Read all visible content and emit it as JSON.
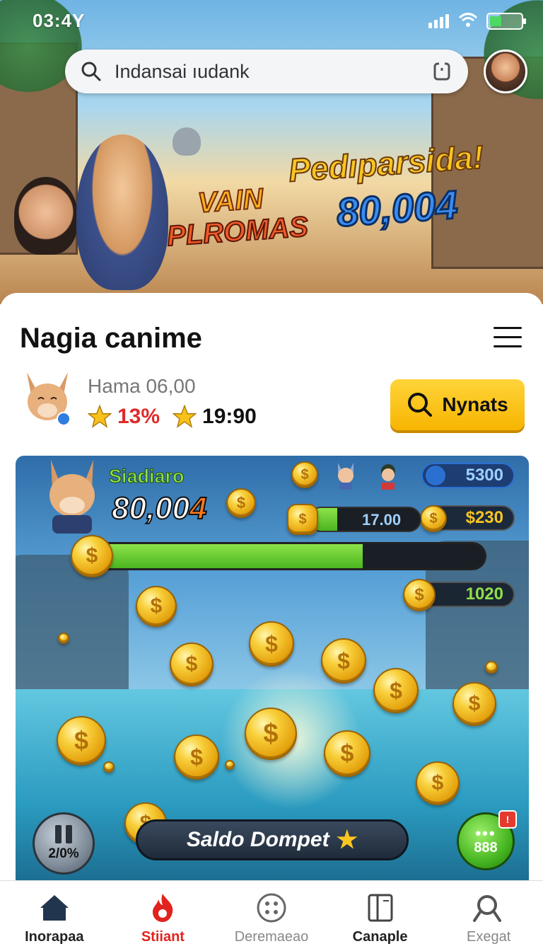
{
  "status_bar": {
    "time": "03:4Y"
  },
  "search": {
    "placeholder": "Indansai ıudank"
  },
  "banner": {
    "game_logo_line1": "VAIN",
    "game_logo_line2": "PLROMAS",
    "promo_title": "Pedıparsida!",
    "promo_amount": "80,004"
  },
  "section": {
    "title": "Nagia canime",
    "player_name": "Hama 06,00",
    "stat_percent": "13%",
    "stat_value": "19:90",
    "search_button": "Nynats"
  },
  "game": {
    "label": "Siadiaro",
    "amount_main": "80,00",
    "amount_suffix": "4",
    "blue_pill": "5300",
    "gold_pill": "$230",
    "small_bar_value": "17.00",
    "small_bar_progress": 0.25,
    "main_bar_progress": 0.69,
    "green_pill": "1020",
    "pause_percent": "2/0%",
    "saldo_button": "Saldo Dompet",
    "green_button_number": "888"
  },
  "bottom_nav": [
    {
      "label": "Inorapaa",
      "icon": "home-icon"
    },
    {
      "label": "Stiiant",
      "icon": "flame-icon"
    },
    {
      "label": "Deremaeao",
      "icon": "grid-icon"
    },
    {
      "label": "Canaple",
      "icon": "book-icon"
    },
    {
      "label": "Exegat",
      "icon": "search-icon"
    }
  ],
  "colors": {
    "accent_yellow": "#f7b500",
    "active_red": "#e0231e",
    "progress_green": "#4bb520"
  }
}
